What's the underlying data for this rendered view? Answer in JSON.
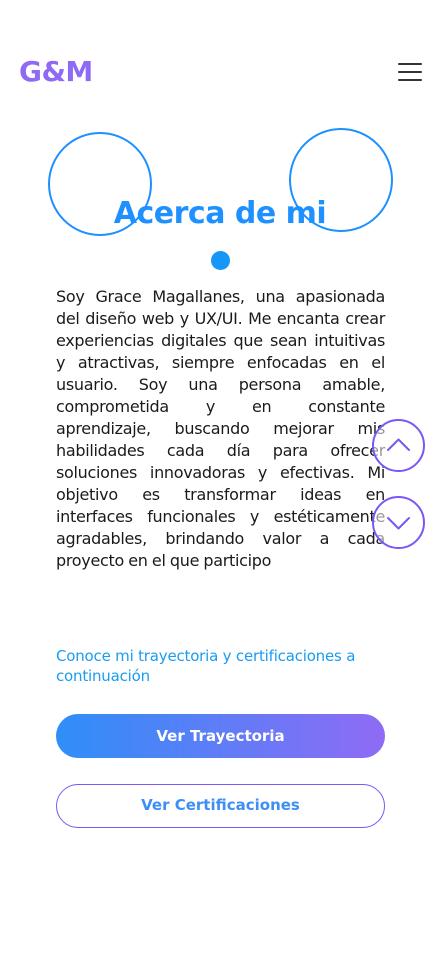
{
  "header": {
    "logo": "G&M",
    "menu_icon": "hamburger-icon"
  },
  "about": {
    "title": "Acerca de mi",
    "bio": "Soy Grace Magallanes, una apasionada del diseño web y UX/UI. Me encanta crear experiencias digitales que sean intuitivas y atractivas, siempre enfocadas en el usuario. Soy una persona amable, comprometida y en constante aprendizaje, buscando mejorar mis habilidades cada día para ofrecer soluciones innovadoras y efectivas. Mi objetivo es transformar ideas en interfaces funcionales y estéticamente agradables, brindando valor a cada proyecto en el que participo",
    "cta_text": "Conoce mi trayectoria y certificaciones a continuación",
    "primary_button": "Ver Trayectoria",
    "secondary_button": "Ver Certificaciones"
  },
  "scroll_nav": {
    "up_icon": "chevron-up-icon",
    "down_icon": "chevron-down-icon"
  },
  "colors": {
    "brand_purple": "#8f6bf5",
    "brand_blue": "#1e90ff",
    "text": "#1a1a1a"
  }
}
